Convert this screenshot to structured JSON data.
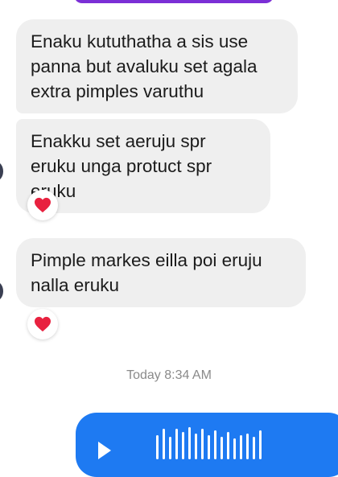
{
  "messages": [
    {
      "text": "Enaku kututhatha a sis use panna but avaluku set agala extra pimples varuthu"
    },
    {
      "text": "Enakku set aeruju spr eruku unga protuct spr eruku",
      "reaction": "heart-icon"
    },
    {
      "text": "Pimple markes eilla poi eruju nalla eruku",
      "reaction": "heart-icon"
    }
  ],
  "timestamp": "Today 8:34 AM",
  "colors": {
    "incoming_bubble": "#efefef",
    "outgoing_bubble": "#1e7af2",
    "reaction_heart": "#e8213f",
    "top_accent": "#7b2fd6"
  },
  "voice_message": {
    "icon": "play-icon",
    "waveform_levels": [
      0.75,
      0.95,
      0.7,
      0.95,
      0.85,
      1.0,
      0.8,
      0.95,
      0.75,
      0.9,
      0.7,
      0.85,
      0.65,
      0.75,
      0.8,
      0.7,
      0.9
    ]
  }
}
